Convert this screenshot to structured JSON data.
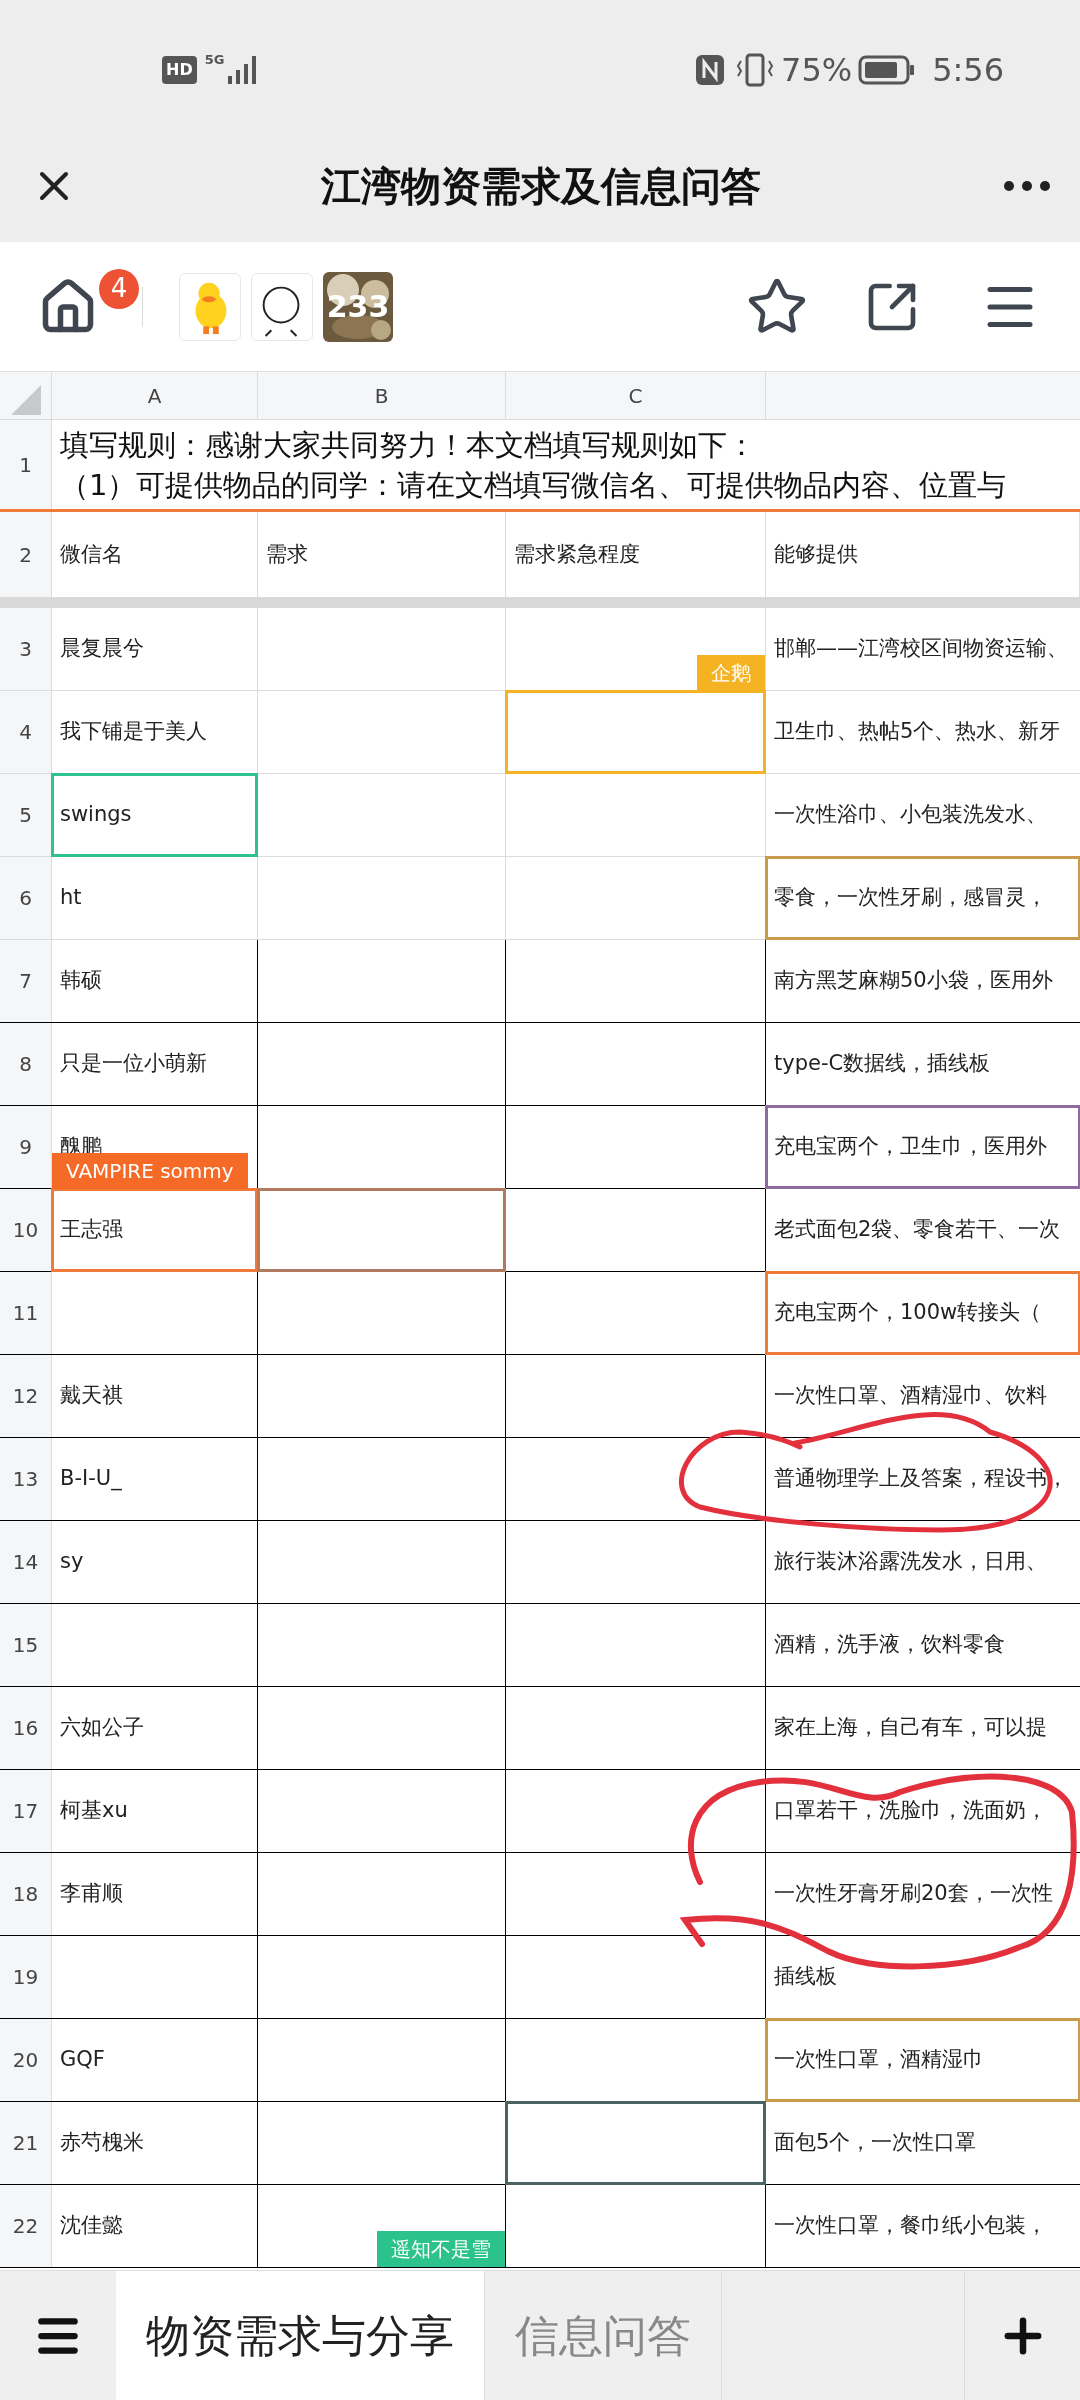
{
  "status_bar": {
    "hd": "HD",
    "network": "5G",
    "battery": "75%",
    "time": "5:56"
  },
  "title_bar": {
    "title": "江湾物资需求及信息问答"
  },
  "toolbar": {
    "home_badge": "4",
    "avatars": [
      {
        "kind": "sticker"
      },
      {
        "kind": "doodle"
      },
      {
        "label": "233"
      }
    ]
  },
  "sheet": {
    "columns": [
      "A",
      "B",
      "C"
    ],
    "title_row": {
      "number": "1",
      "lines": [
        "填写规则：感谢大家共同努力！本文档填写规则如下：",
        "（1）可提供物品的同学：请在文档填写微信名、可提供物品内容、位置与"
      ]
    },
    "header_row": {
      "number": "2",
      "cells": [
        "微信名",
        "需求",
        "需求紧急程度",
        "能够提供"
      ]
    },
    "rows": [
      {
        "number": "3",
        "kind": "plain",
        "cells": [
          {
            "text": "晨复晨兮"
          },
          {},
          {},
          {
            "text": "邯郸——江湾校区间物资运输、"
          }
        ]
      },
      {
        "number": "4",
        "kind": "plain",
        "cells": [
          {
            "text": "我下铺是于美人"
          },
          {},
          {
            "color": "#f5b324",
            "tag": {
              "text": "企鹅",
              "color": "#f5b324",
              "kind": "right"
            }
          },
          {
            "text": "卫生巾、热帖5个、热水、新牙"
          }
        ]
      },
      {
        "number": "5",
        "kind": "plain",
        "cells": [
          {
            "text": "swings",
            "color": "#2ec28e"
          },
          {},
          {},
          {
            "text": "一次性浴巾、小包装洗发水、"
          }
        ]
      },
      {
        "number": "6",
        "kind": "plain",
        "cells": [
          {
            "text": "ht"
          },
          {},
          {},
          {
            "text": "零食，一次性牙刷，感冒灵，",
            "color": "#c99a4a"
          }
        ]
      },
      {
        "number": "7",
        "kind": "ruled",
        "cells": [
          {
            "text": "韩硕"
          },
          {},
          {},
          {
            "text": "南方黑芝麻糊50小袋，医用外"
          }
        ]
      },
      {
        "number": "8",
        "kind": "ruled",
        "cells": [
          {
            "text": "只是一位小萌新"
          },
          {},
          {},
          {
            "text": "type-C数据线，插线板"
          }
        ]
      },
      {
        "number": "9",
        "kind": "ruled",
        "cells": [
          {
            "text": "醜鹏"
          },
          {},
          {},
          {
            "text": "充电宝两个，卫生巾，医用外",
            "color": "#8e6aa0"
          }
        ]
      },
      {
        "number": "10",
        "kind": "ruled",
        "cells": [
          {
            "text": "王志强",
            "color": "#f07a3a",
            "tag": {
              "text": "VAMPIRE sommy",
              "color": "#f46a26",
              "kind": "left"
            }
          },
          {
            "color": "#b07a60"
          },
          {},
          {
            "text": "老式面包2袋、零食若干、一次"
          }
        ]
      },
      {
        "number": "11",
        "kind": "ruled",
        "cells": [
          {},
          {},
          {},
          {
            "text": "充电宝两个，100w转接头（",
            "color": "#f07a3a"
          }
        ]
      },
      {
        "number": "12",
        "kind": "ruled",
        "cells": [
          {
            "text": "戴天祺"
          },
          {},
          {},
          {
            "text": "一次性口罩、酒精湿巾、饮料"
          }
        ]
      },
      {
        "number": "13",
        "kind": "ruled",
        "cells": [
          {
            "text": "B-I-U_"
          },
          {},
          {},
          {
            "text": "普通物理学上及答案，程设书，"
          }
        ]
      },
      {
        "number": "14",
        "kind": "ruled",
        "cells": [
          {
            "text": "sy"
          },
          {},
          {},
          {
            "text": "旅行装沐浴露洗发水，日用、"
          }
        ]
      },
      {
        "number": "15",
        "kind": "ruled",
        "cells": [
          {},
          {},
          {},
          {
            "text": "酒精，洗手液，饮料零食"
          }
        ]
      },
      {
        "number": "16",
        "kind": "ruled",
        "cells": [
          {
            "text": "六如公子"
          },
          {},
          {},
          {
            "text": "家在上海，自己有车，可以提"
          }
        ]
      },
      {
        "number": "17",
        "kind": "ruled",
        "cells": [
          {
            "text": "柯基xu"
          },
          {},
          {},
          {
            "text": "口罩若干，洗脸巾，洗面奶，"
          }
        ]
      },
      {
        "number": "18",
        "kind": "ruled",
        "cells": [
          {
            "text": "李甫顺"
          },
          {},
          {},
          {
            "text": "一次性牙膏牙刷20套，一次性"
          }
        ]
      },
      {
        "number": "19",
        "kind": "ruled",
        "cells": [
          {},
          {},
          {},
          {
            "text": "插线板"
          }
        ]
      },
      {
        "number": "20",
        "kind": "ruled",
        "cells": [
          {
            "text": "GQF"
          },
          {},
          {},
          {
            "text": "一次性口罩，酒精湿巾",
            "color": "#c99a4a"
          }
        ]
      },
      {
        "number": "21",
        "kind": "ruled",
        "cells": [
          {
            "text": "赤芍槐米"
          },
          {},
          {
            "color": "#4a6464"
          },
          {
            "text": "面包5个，一次性口罩"
          }
        ]
      },
      {
        "number": "22",
        "kind": "ruled",
        "cells": [
          {
            "text": "沈佳懿"
          },
          {
            "tag": {
              "text": "遥知不是雪",
              "color": "#2bc28c",
              "kind": "below"
            }
          },
          {},
          {
            "text": "一次性口罩，餐巾纸小包装，"
          }
        ]
      }
    ]
  },
  "sheet_tabs": [
    {
      "label": "物资需求与分享",
      "selected": true
    },
    {
      "label": "信息问答",
      "selected": false
    }
  ]
}
